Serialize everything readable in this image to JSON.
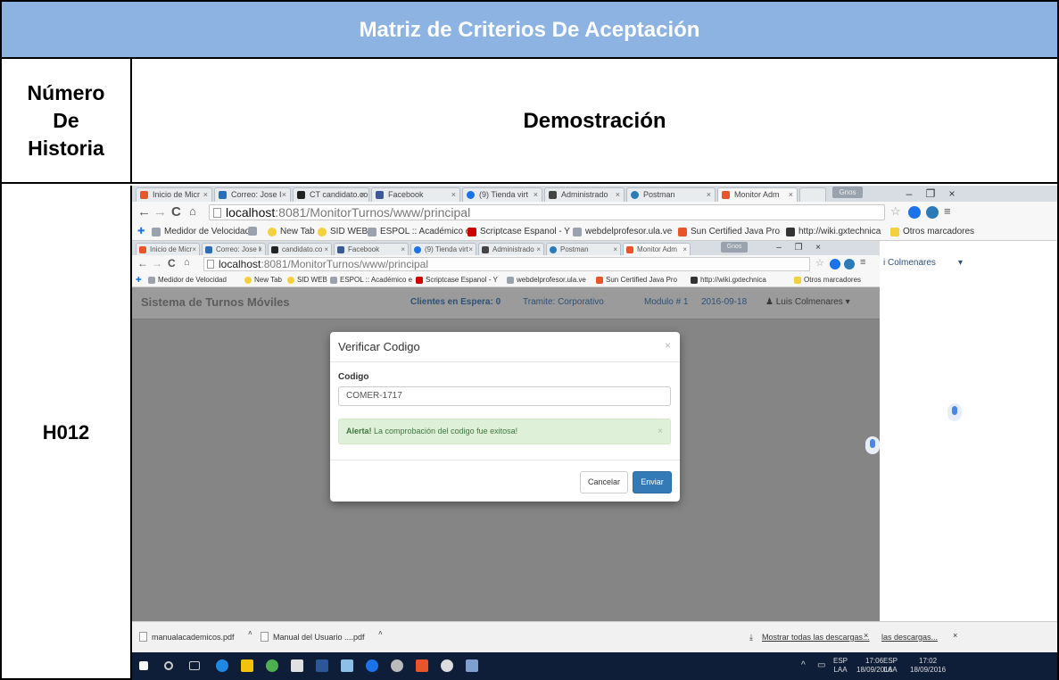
{
  "matrix": {
    "title": "Matriz de Criterios De Aceptación",
    "col_header_lines": [
      "Número",
      "De",
      "Historia"
    ],
    "demo_header": "Demostración",
    "story_id": "H012"
  },
  "outer_browser": {
    "tabs": [
      {
        "label": "Inicio de Micr",
        "color": "#e8552b"
      },
      {
        "label": "Correo: Jose I",
        "color": "#2a6ebb"
      },
      {
        "label": "CT candidato.co",
        "color": "#222222"
      },
      {
        "label": "Facebook",
        "color": "#3b5998"
      },
      {
        "label": "(9) Tienda virt",
        "color": "#1a73e8"
      },
      {
        "label": "Administrado",
        "color": "#444444"
      },
      {
        "label": "Postman",
        "color": "#2b7bb9"
      },
      {
        "label": "Monitor Adm",
        "color": "#e8552b"
      }
    ],
    "profile": "Gnos",
    "url_domain": "localhost",
    "url_path": ":8081/MonitorTurnos/www/principal",
    "bookmarks": [
      {
        "label": "Medidor de Velocidad",
        "color": "#9aa3ad"
      },
      {
        "label": "New Tab",
        "color": "#f4d03f"
      },
      {
        "label": "SID WEB",
        "color": "#f4d03f"
      },
      {
        "label": "ESPOL :: Académico e",
        "color": "#9aa3ad"
      },
      {
        "label": "Scriptcase Espanol - Y",
        "color": "#cc0000"
      },
      {
        "label": "webdelprofesor.ula.ve",
        "color": "#9aa3ad"
      },
      {
        "label": "Sun Certified Java Pro",
        "color": "#e8552b"
      },
      {
        "label": "http://wiki.gxtechnica",
        "color": "#333333"
      }
    ],
    "other_bookmarks": "Otros marcadores"
  },
  "inner_browser": {
    "tabs": [
      "Inicio de Micr",
      "Correo: Jose I",
      "candidato.co",
      "Facebook",
      "(9) Tienda virt",
      "Administrado",
      "Postman",
      "Monitor Adm"
    ],
    "profile": "Gnos",
    "url_domain": "localhost",
    "url_path": ":8081/MonitorTurnos/www/principal",
    "bookmarks": [
      "Medidor de Velocidad",
      "New Tab",
      "SID WEB",
      "ESPOL :: Académico e",
      "Scriptcase Espanol - Y",
      "webdelprofesor.ula.ve",
      "Sun Certified Java Pro",
      "http://wiki.gxtechnica"
    ],
    "other_bookmarks": "Otros marcadores"
  },
  "app": {
    "brand": "Sistema de Turnos Móviles",
    "clients_waiting": "Clientes en Espera: 0",
    "tramite": "Tramite: Corporativo",
    "modulo": "Modulo # 1",
    "date": "2016-09-18",
    "user": "Luis Colmenares",
    "right_user_fragment": "i Colmenares"
  },
  "modal": {
    "title": "Verificar Codigo",
    "close": "×",
    "field_label": "Codigo",
    "field_value": "COMER-1717",
    "alert_strong": "Alerta!",
    "alert_text": " La comprobación del codigo fue exitosa!",
    "alert_close": "×",
    "cancel_label": "Cancelar",
    "submit_label": "Enviar"
  },
  "downloads": {
    "items": [
      "manualacademicos.pdf",
      "Manual del Usuario ....pdf"
    ],
    "show_all": "Mostrar todas las descargas...",
    "show_all_right": "las descargas..."
  },
  "taskbar": {
    "lang": "ESP",
    "region": "LAA",
    "time_left": "17:06",
    "date_left": "18/09/2016",
    "time_right": "17:02",
    "date_right": "18/09/2016"
  },
  "colors": {
    "header_blue": "#8db3e2",
    "alert_green_bg": "#dff0d8",
    "primary_blue": "#337ab7",
    "taskbar": "#0e1d38"
  }
}
